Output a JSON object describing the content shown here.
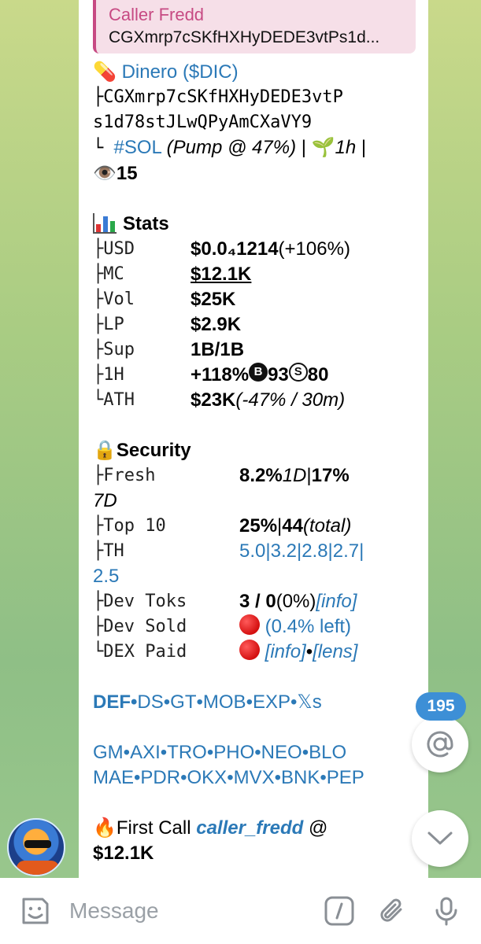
{
  "reply": {
    "name": "Caller Fredd",
    "text": "CGXmrp7cSKfHXHyDEDE3vtPs1d..."
  },
  "token": {
    "emoji": "💊",
    "name": "Dinero",
    "ticker": "($DIC)",
    "addr_prefix": "├",
    "address_line1": "CGXmrp7cSKfHXHyDEDE3vtP",
    "address_line2": "s1d78stJLwQPyAmCXaVY9",
    "chain_prefix": "└ ",
    "chain": "#SOL",
    "pump": "(Pump @ 47%)",
    "sep1": " | ",
    "sprout": "🌱",
    "age": "1h",
    "sep2": " |",
    "eye": "👁️",
    "views": "15"
  },
  "stats": {
    "title": "Stats",
    "rows": [
      {
        "key": "├USD",
        "value": "$0.0₄1214",
        "extra": " (+106%)"
      },
      {
        "key": "├MC",
        "value": "$12.1K",
        "extra": ""
      },
      {
        "key": "├Vol",
        "value": "$25K",
        "extra": ""
      },
      {
        "key": "├LP",
        "value": "$2.9K",
        "extra": ""
      },
      {
        "key": "├Sup",
        "value": "1B/1B",
        "extra": ""
      },
      {
        "key": "├1H",
        "value": "+118% ",
        "b_icon": "B",
        "b_val": " 93 ",
        "s_icon": "S",
        "s_val": " 80"
      },
      {
        "key": "└ATH",
        "value": "$23K",
        "extra": " (-47% / 30m)"
      }
    ]
  },
  "security": {
    "emoji": "🔒",
    "title": "Security",
    "fresh_key": "├Fresh",
    "fresh_val": "8.2%",
    "fresh_period": " 1D",
    "fresh_sep": " | ",
    "fresh_val2": "17%",
    "fresh_period2": "7D",
    "top10_key": "├Top 10",
    "top10_val": "25%",
    "top10_sep": " | ",
    "top10_count": "44",
    "top10_total": " (total)",
    "th_key": "├TH",
    "th_line1": "5.0|3.2|2.8|2.7|",
    "th_line2": "2.5",
    "devtoks_key": "├Dev Toks",
    "devtoks_val": "3 / 0",
    "devtoks_pct": " (0%)  ",
    "devtoks_link": "[info]",
    "devsold_key": "├Dev Sold",
    "devsold_link": "(0.4% left)",
    "dexpaid_key": "└DEX Paid",
    "dexpaid_link1": "[info]",
    "dexpaid_sep": " • ",
    "dexpaid_link2": "[lens]"
  },
  "links": {
    "row1": [
      "DEF",
      "DS",
      "GT",
      "MOB",
      "EXP",
      "𝕏s"
    ],
    "row2": [
      "GM",
      "AXI",
      "TRO",
      "PHO",
      "NEO",
      "BLO"
    ],
    "row3": [
      "MAE",
      "PDR",
      "OKX",
      "MVX",
      "BNK",
      "PEP"
    ],
    "sep": "•"
  },
  "first_call": {
    "emoji": "🔥",
    "label": "First Call ",
    "user": "caller_fredd",
    "at": " @",
    "value": "$12.1K"
  },
  "badge_count": "195",
  "composer": {
    "placeholder": "Message"
  },
  "colors": {
    "link": "#2b79b7",
    "reply_accent": "#c74a83",
    "badge": "#3d8fd6"
  }
}
